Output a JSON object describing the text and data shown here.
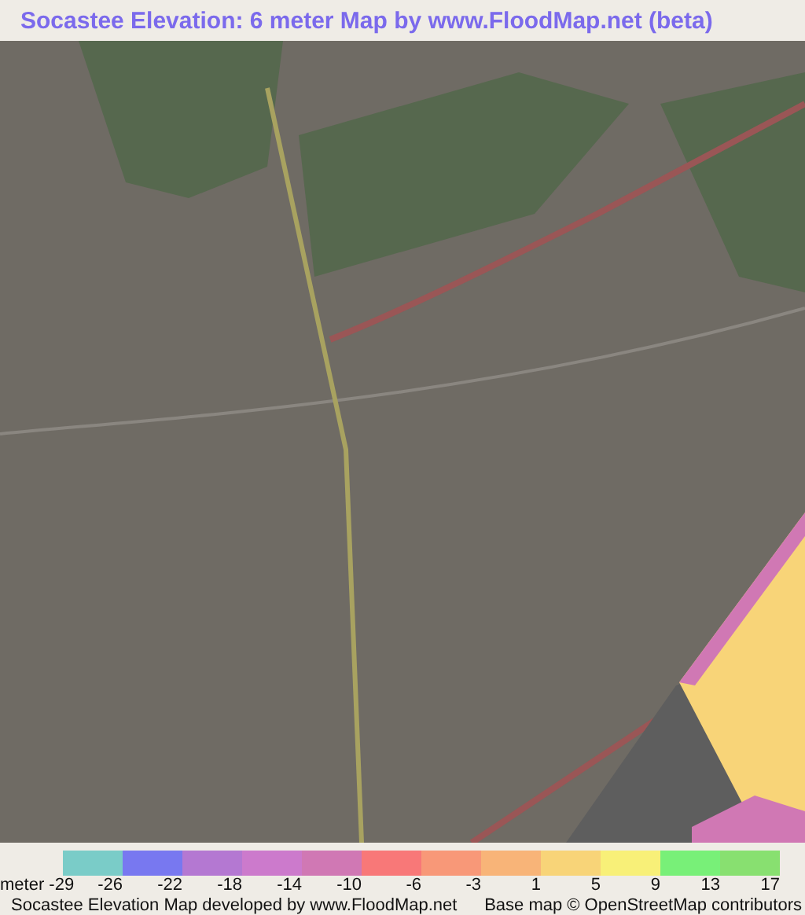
{
  "title": "Socastee Elevation: 6 meter Map by www.FloodMap.net (beta)",
  "legend": {
    "swatches": [
      {
        "color": "#7accc8"
      },
      {
        "color": "#7878f0"
      },
      {
        "color": "#b478d2"
      },
      {
        "color": "#cc7acc"
      },
      {
        "color": "#d078b4"
      },
      {
        "color": "#f87878"
      },
      {
        "color": "#f89878"
      },
      {
        "color": "#f8b478"
      },
      {
        "color": "#f8d478"
      },
      {
        "color": "#f8f078"
      },
      {
        "color": "#78f078"
      },
      {
        "color": "#88e070"
      }
    ],
    "unit": "meter",
    "ticks": [
      "-29",
      "-26",
      "-22",
      "-18",
      "-14",
      "-10",
      "-6",
      "-3",
      "1",
      "5",
      "9",
      "13",
      "17"
    ]
  },
  "footer": {
    "left": "Socastee Elevation Map developed by www.FloodMap.net",
    "right": "Base map © OpenStreetMap contributors"
  }
}
